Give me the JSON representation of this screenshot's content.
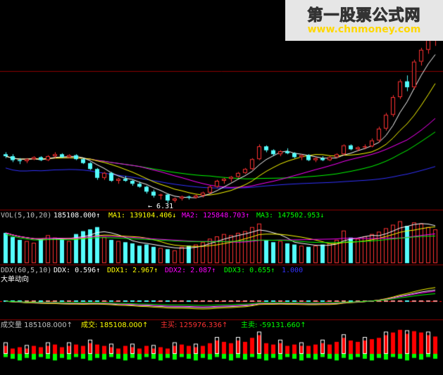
{
  "watermark": {
    "line1": "第一股票公式网",
    "line2": "www.chnmoney.com"
  },
  "price_panel": {
    "low_marker": "6.31"
  },
  "vol_header": {
    "prefix": "VOL(5,10,20)",
    "value": "185108.000↑",
    "ma1": "MA1: 139104.406↓",
    "ma2": "MA2: 125848.703↑",
    "ma3": "MA3: 147502.953↓"
  },
  "ddx_header": {
    "prefix": "DDX(60,5,10)",
    "ddx": "DDX: 0.596↑",
    "ddx1": "DDX1: 2.967↑",
    "ddx2": "DDX2: 2.087↑",
    "ddx3": "DDX3: 0.655↑",
    "ddx4": "1.000",
    "subtitle": "大单动向"
  },
  "flow_header": {
    "vol": "成交量 185108.000↑",
    "trade": "成交: 185108.000↑",
    "buy": "主买: 125976.336↑",
    "sell": "主卖: -59131.660↑"
  },
  "colors": {
    "up": "#ff3232",
    "down": "#54fcfc",
    "ma5": "#ffffff",
    "ma10": "#ffff00",
    "ma20": "#ff00ff",
    "ma30": "#00ff00",
    "ma60": "#3232ff",
    "grid": "#8b0000",
    "buy": "#ff0000",
    "sell": "#00ff00"
  },
  "chart_data": {
    "type": "candlestick",
    "note_units": "price units as read from chart, approximate",
    "candles": [
      [
        8.8,
        8.9,
        8.6,
        8.7
      ],
      [
        8.7,
        8.8,
        8.4,
        8.5
      ],
      [
        8.5,
        8.6,
        8.3,
        8.45
      ],
      [
        8.45,
        8.6,
        8.35,
        8.55
      ],
      [
        8.55,
        8.7,
        8.5,
        8.65
      ],
      [
        8.65,
        8.7,
        8.45,
        8.5
      ],
      [
        8.5,
        8.75,
        8.45,
        8.7
      ],
      [
        8.7,
        8.9,
        8.6,
        8.8
      ],
      [
        8.8,
        8.85,
        8.6,
        8.65
      ],
      [
        8.65,
        8.8,
        8.6,
        8.75
      ],
      [
        8.75,
        8.8,
        8.5,
        8.55
      ],
      [
        8.55,
        8.6,
        8.3,
        8.35
      ],
      [
        8.35,
        8.4,
        8.0,
        8.05
      ],
      [
        8.05,
        8.1,
        7.5,
        7.6
      ],
      [
        7.6,
        7.9,
        7.5,
        7.85
      ],
      [
        7.85,
        7.9,
        7.4,
        7.45
      ],
      [
        7.45,
        7.6,
        7.3,
        7.55
      ],
      [
        7.55,
        7.7,
        7.4,
        7.45
      ],
      [
        7.45,
        7.5,
        7.2,
        7.3
      ],
      [
        7.3,
        7.4,
        7.1,
        7.15
      ],
      [
        7.15,
        7.2,
        6.8,
        6.9
      ],
      [
        6.9,
        7.0,
        6.6,
        6.7
      ],
      [
        6.7,
        6.8,
        6.5,
        6.75
      ],
      [
        6.75,
        6.8,
        6.31,
        6.45
      ],
      [
        6.45,
        6.6,
        6.35,
        6.55
      ],
      [
        6.55,
        6.7,
        6.45,
        6.65
      ],
      [
        6.65,
        6.7,
        6.5,
        6.6
      ],
      [
        6.6,
        6.75,
        6.55,
        6.7
      ],
      [
        6.7,
        6.9,
        6.6,
        6.85
      ],
      [
        6.85,
        7.2,
        6.8,
        7.15
      ],
      [
        7.15,
        7.5,
        7.1,
        7.45
      ],
      [
        7.45,
        7.6,
        7.3,
        7.55
      ],
      [
        7.55,
        7.7,
        7.4,
        7.65
      ],
      [
        7.65,
        7.9,
        7.6,
        7.85
      ],
      [
        7.85,
        8.1,
        7.8,
        8.05
      ],
      [
        8.05,
        8.6,
        8.0,
        8.55
      ],
      [
        8.55,
        9.3,
        8.5,
        9.2
      ],
      [
        9.2,
        9.25,
        8.9,
        9.0
      ],
      [
        9.0,
        9.05,
        8.7,
        8.8
      ],
      [
        8.8,
        9.0,
        8.7,
        8.95
      ],
      [
        8.95,
        9.1,
        8.8,
        8.85
      ],
      [
        8.85,
        8.9,
        8.6,
        8.65
      ],
      [
        8.65,
        8.8,
        8.5,
        8.75
      ],
      [
        8.75,
        8.8,
        8.45,
        8.5
      ],
      [
        8.5,
        8.65,
        8.4,
        8.6
      ],
      [
        8.6,
        8.7,
        8.45,
        8.5
      ],
      [
        8.5,
        8.7,
        8.45,
        8.65
      ],
      [
        8.65,
        8.85,
        8.6,
        8.8
      ],
      [
        8.8,
        9.3,
        8.75,
        9.25
      ],
      [
        9.25,
        9.3,
        9.0,
        9.05
      ],
      [
        9.05,
        9.2,
        8.95,
        9.15
      ],
      [
        9.15,
        9.3,
        9.05,
        9.2
      ],
      [
        9.2,
        9.6,
        9.15,
        9.5
      ],
      [
        9.5,
        10.2,
        9.4,
        10.1
      ],
      [
        10.1,
        10.9,
        10.0,
        10.8
      ],
      [
        10.8,
        11.8,
        10.7,
        11.7
      ],
      [
        11.7,
        12.6,
        11.6,
        12.5
      ],
      [
        12.5,
        12.8,
        12.0,
        12.2
      ],
      [
        12.2,
        13.6,
        12.1,
        13.5
      ],
      [
        13.5,
        14.2,
        13.3,
        14.1
      ],
      [
        14.1,
        14.8,
        13.9,
        14.6
      ],
      [
        14.6,
        15.0,
        14.3,
        14.9
      ]
    ],
    "vol_values": [
      52,
      45,
      40,
      38,
      35,
      42,
      48,
      44,
      40,
      38,
      50,
      55,
      58,
      62,
      45,
      40,
      38,
      36,
      34,
      30,
      32,
      28,
      26,
      24,
      22,
      28,
      30,
      32,
      36,
      42,
      46,
      50,
      48,
      52,
      55,
      62,
      68,
      40,
      36,
      38,
      34,
      32,
      30,
      28,
      30,
      32,
      34,
      40,
      56,
      44,
      42,
      46,
      50,
      54,
      60,
      66,
      72,
      64,
      70,
      68,
      62,
      58
    ],
    "flow_values": [
      0.3,
      0.2,
      0.25,
      0.2,
      0.3,
      0.25,
      0.3,
      0.35,
      0.25,
      0.3,
      0.35,
      0.3,
      0.4,
      0.35,
      0.3,
      0.25,
      0.2,
      0.3,
      0.25,
      0.2,
      0.3,
      0.2,
      0.25,
      0.2,
      0.3,
      0.35,
      0.3,
      0.25,
      0.3,
      0.4,
      0.5,
      0.45,
      0.4,
      0.5,
      0.45,
      0.6,
      0.7,
      0.4,
      0.35,
      0.4,
      0.3,
      0.35,
      0.3,
      0.3,
      0.35,
      0.4,
      0.35,
      0.45,
      0.6,
      0.5,
      0.45,
      0.5,
      0.55,
      0.6,
      0.7,
      0.8,
      0.9,
      0.75,
      0.85,
      0.8,
      0.7,
      0.65
    ]
  }
}
